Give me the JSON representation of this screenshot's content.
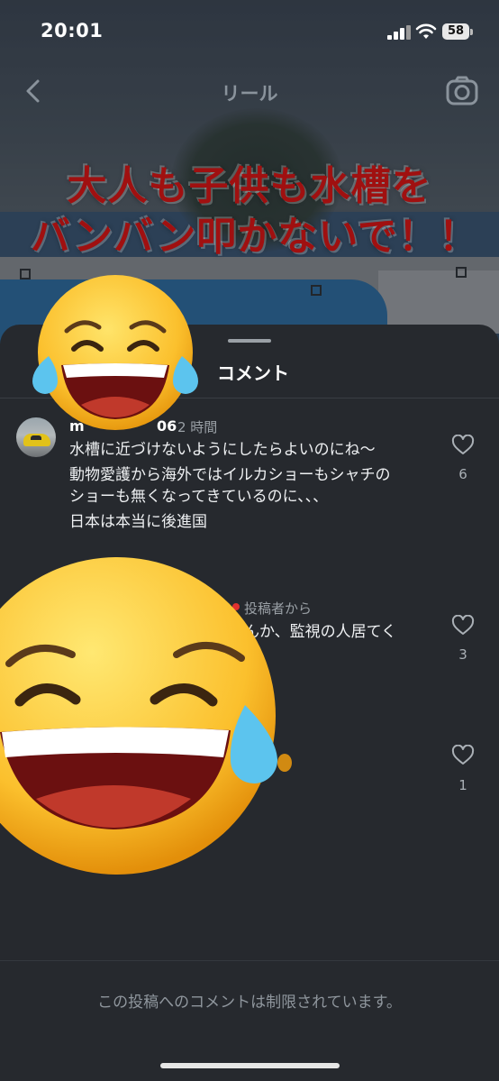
{
  "status": {
    "time": "20:01",
    "battery": "58"
  },
  "nav": {
    "title": "リール"
  },
  "caption": {
    "line1": "大人も子供も水槽を",
    "line2": "バンバン叩かないで！！"
  },
  "sheet": {
    "title": "コメント"
  },
  "comments": [
    {
      "username_visible": "m",
      "username_tail": "06",
      "time": "2 時間",
      "lines": [
        "水槽に近づけないようにしたらよいのにね〜",
        "動物愛護から海外ではイルカショーもシャチの",
        "ショーも無くなってきているのに、、、",
        "日本は本当に後進国"
      ],
      "likes": "6"
    },
    {
      "badge": "投稿者から",
      "lines": [
        "んか、監視の人居てく"
      ],
      "likes": "3"
    },
    {
      "likes": "1"
    }
  ],
  "footer": {
    "note": "この投稿へのコメントは制限されています。"
  },
  "colors": {
    "caption": "#a01010",
    "author_dot": "#e0312f",
    "sheet_bg": "#26292e"
  },
  "icons": [
    "back-icon",
    "camera-icon",
    "heart-icon",
    "wifi-icon",
    "signal-icon",
    "battery-icon",
    "crying-laughing-emoji"
  ]
}
